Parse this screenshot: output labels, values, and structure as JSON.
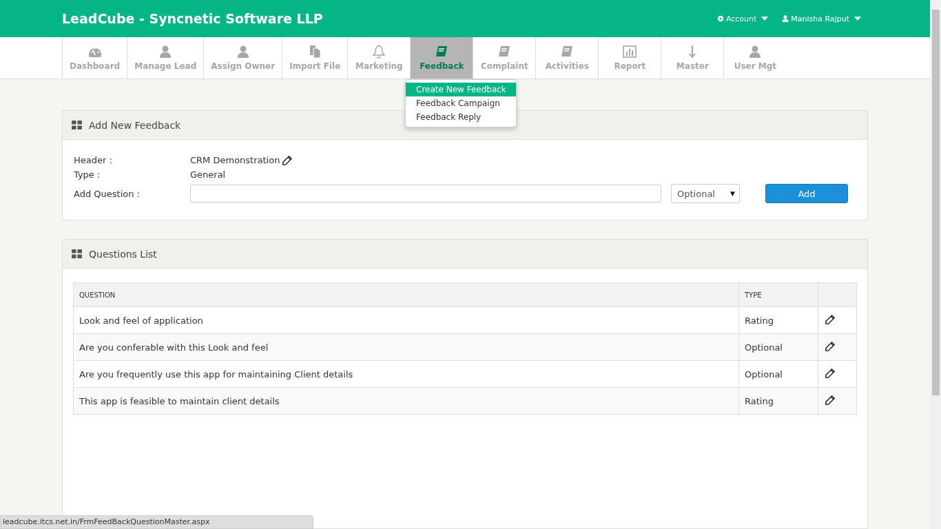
{
  "header": {
    "brand": "LeadCube - Syncnetic Software LLP",
    "menus": [
      {
        "label": "Account",
        "kind": "gear"
      },
      {
        "label": "Manisha Rajput",
        "kind": "user"
      }
    ]
  },
  "nav": {
    "tabs": [
      {
        "label": "Dashboard",
        "selected": false
      },
      {
        "label": "Manage Lead",
        "selected": false
      },
      {
        "label": "Assign Owner",
        "selected": false
      },
      {
        "label": "Import File",
        "selected": false
      },
      {
        "label": "Marketing",
        "selected": false
      },
      {
        "label": "Feedback",
        "selected": true
      },
      {
        "label": "Complaint",
        "selected": false
      },
      {
        "label": "Activities",
        "selected": false
      },
      {
        "label": "Report",
        "selected": false
      },
      {
        "label": "Master",
        "selected": false
      },
      {
        "label": "User Mgt",
        "selected": false
      }
    ],
    "dropdown": [
      {
        "label": "Create New Feedback",
        "selected": true
      },
      {
        "label": "Feedback Campaign",
        "selected": false
      },
      {
        "label": "Feedback Reply",
        "selected": false
      }
    ]
  },
  "add_panel": {
    "title": "Add New Feedback",
    "header_label": "Header :",
    "header_value": "CRM Demonstration",
    "type_label": "Type :",
    "type_value": "General",
    "question_label": "Add Question :",
    "type_select": "Optional",
    "select_arrow": "▼",
    "add_button": "Add"
  },
  "questions_panel": {
    "title": "Questions List",
    "columns": [
      "QUESTION",
      "TYPE"
    ],
    "rows": [
      {
        "question": "Look and feel of application",
        "type": "Rating"
      },
      {
        "question": "Are you conferable with this Look and feel",
        "type": "Optional"
      },
      {
        "question": "Are you frequently use this app for maintaining Client details",
        "type": "Optional"
      },
      {
        "question": "This app is feasible to maintain client details",
        "type": "Rating"
      }
    ]
  },
  "status_bar": "leadcube.itcs.net.in/FrmFeedBackQuestionMaster.aspx"
}
